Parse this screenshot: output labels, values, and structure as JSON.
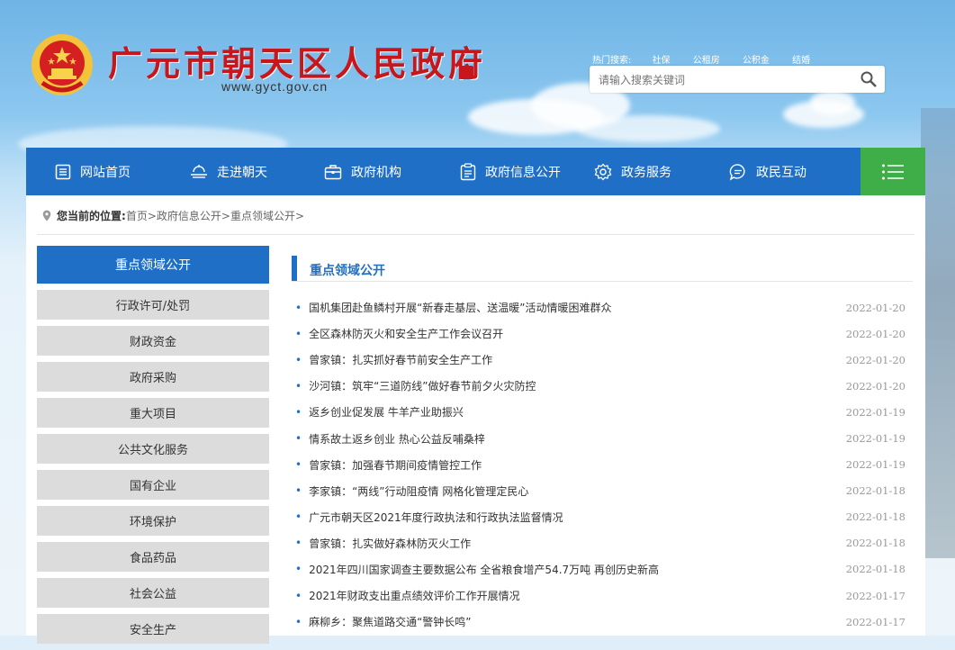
{
  "header": {
    "title": "广元市朝天区人民政府",
    "url": "www.gyct.gov.cn",
    "hot_label": "热门搜索:",
    "hot_links": [
      "社保",
      "公租房",
      "公积金",
      "结婚"
    ],
    "search_placeholder": "请输入搜索关键词"
  },
  "nav": {
    "items": [
      {
        "label": "网站首页",
        "icon": "document-icon"
      },
      {
        "label": "走进朝天",
        "icon": "landscape-icon"
      },
      {
        "label": "政府机构",
        "icon": "briefcase-icon"
      },
      {
        "label": "政府信息公开",
        "icon": "clipboard-icon"
      },
      {
        "label": "政务服务",
        "icon": "gear-icon"
      },
      {
        "label": "政民互动",
        "icon": "chat-icon"
      }
    ],
    "menu_icon": "menu-icon",
    "menu_color": "#3fae49"
  },
  "breadcrumb": {
    "label": "您当前的位置:",
    "items": [
      "首页",
      "政府信息公开",
      "重点领域公开"
    ]
  },
  "sidebar": {
    "title": "重点领域公开",
    "items": [
      "行政许可/处罚",
      "财政资金",
      "政府采购",
      "重大项目",
      "公共文化服务",
      "国有企业",
      "环境保护",
      "食品药品",
      "社会公益",
      "安全生产"
    ]
  },
  "main": {
    "title": "重点领域公开",
    "articles": [
      {
        "title": "国机集团赴鱼鳞村开展“新春走基层、送温暖”活动情暖困难群众",
        "date": "2022-01-20"
      },
      {
        "title": "全区森林防灭火和安全生产工作会议召开",
        "date": "2022-01-20"
      },
      {
        "title": "曾家镇：扎实抓好春节前安全生产工作",
        "date": "2022-01-20"
      },
      {
        "title": "沙河镇：筑牢“三道防线”做好春节前夕火灾防控",
        "date": "2022-01-20"
      },
      {
        "title": "返乡创业促发展 牛羊产业助振兴",
        "date": "2022-01-19"
      },
      {
        "title": "情系故土返乡创业 热心公益反哺桑梓",
        "date": "2022-01-19"
      },
      {
        "title": "曾家镇：加强春节期间疫情管控工作",
        "date": "2022-01-19"
      },
      {
        "title": "李家镇：“两线”行动阻疫情 网格化管理定民心",
        "date": "2022-01-18"
      },
      {
        "title": "广元市朝天区2021年度行政执法和行政执法监督情况",
        "date": "2022-01-18"
      },
      {
        "title": "曾家镇：扎实做好森林防灭火工作",
        "date": "2022-01-18"
      },
      {
        "title": "2021年四川国家调查主要数据公布 全省粮食增产54.7万吨 再创历史新高",
        "date": "2022-01-18"
      },
      {
        "title": "2021年财政支出重点绩效评价工作开展情况",
        "date": "2022-01-17"
      },
      {
        "title": "麻柳乡：聚焦道路交通“警钟长鸣”",
        "date": "2022-01-17"
      }
    ]
  },
  "colors": {
    "primary": "#1f6fc7",
    "brand_red": "#c8161d"
  }
}
